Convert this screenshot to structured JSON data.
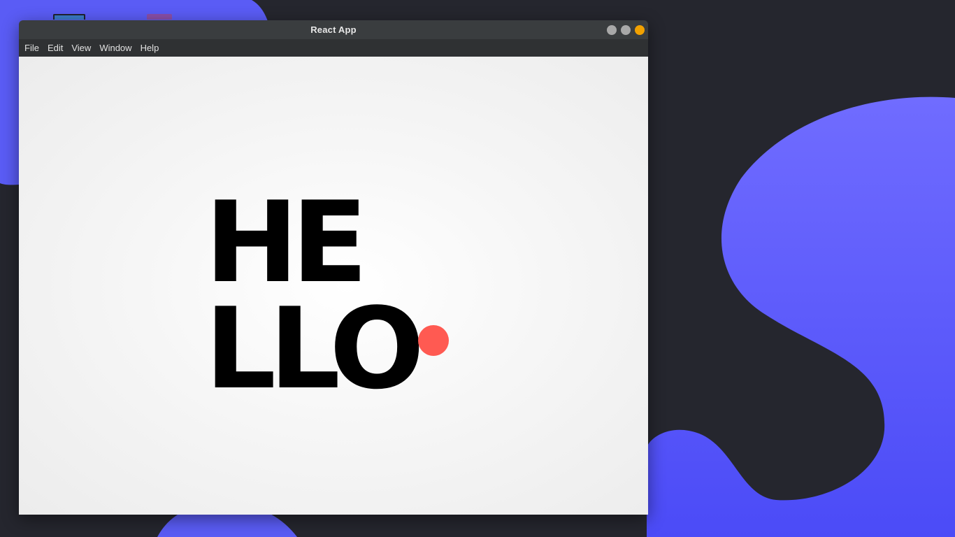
{
  "window": {
    "title": "React App"
  },
  "menubar": {
    "items": [
      "File",
      "Edit",
      "View",
      "Window",
      "Help"
    ]
  },
  "content": {
    "line1": "HE",
    "line2": "LLO",
    "dot_color": "#ff5a52"
  },
  "colors": {
    "desktop_background": "#25262e",
    "wallpaper_accent": "#5b5cf6",
    "titlebar": "#3a3d3f",
    "menubar": "#2f3133",
    "close_button": "#f2a100"
  }
}
